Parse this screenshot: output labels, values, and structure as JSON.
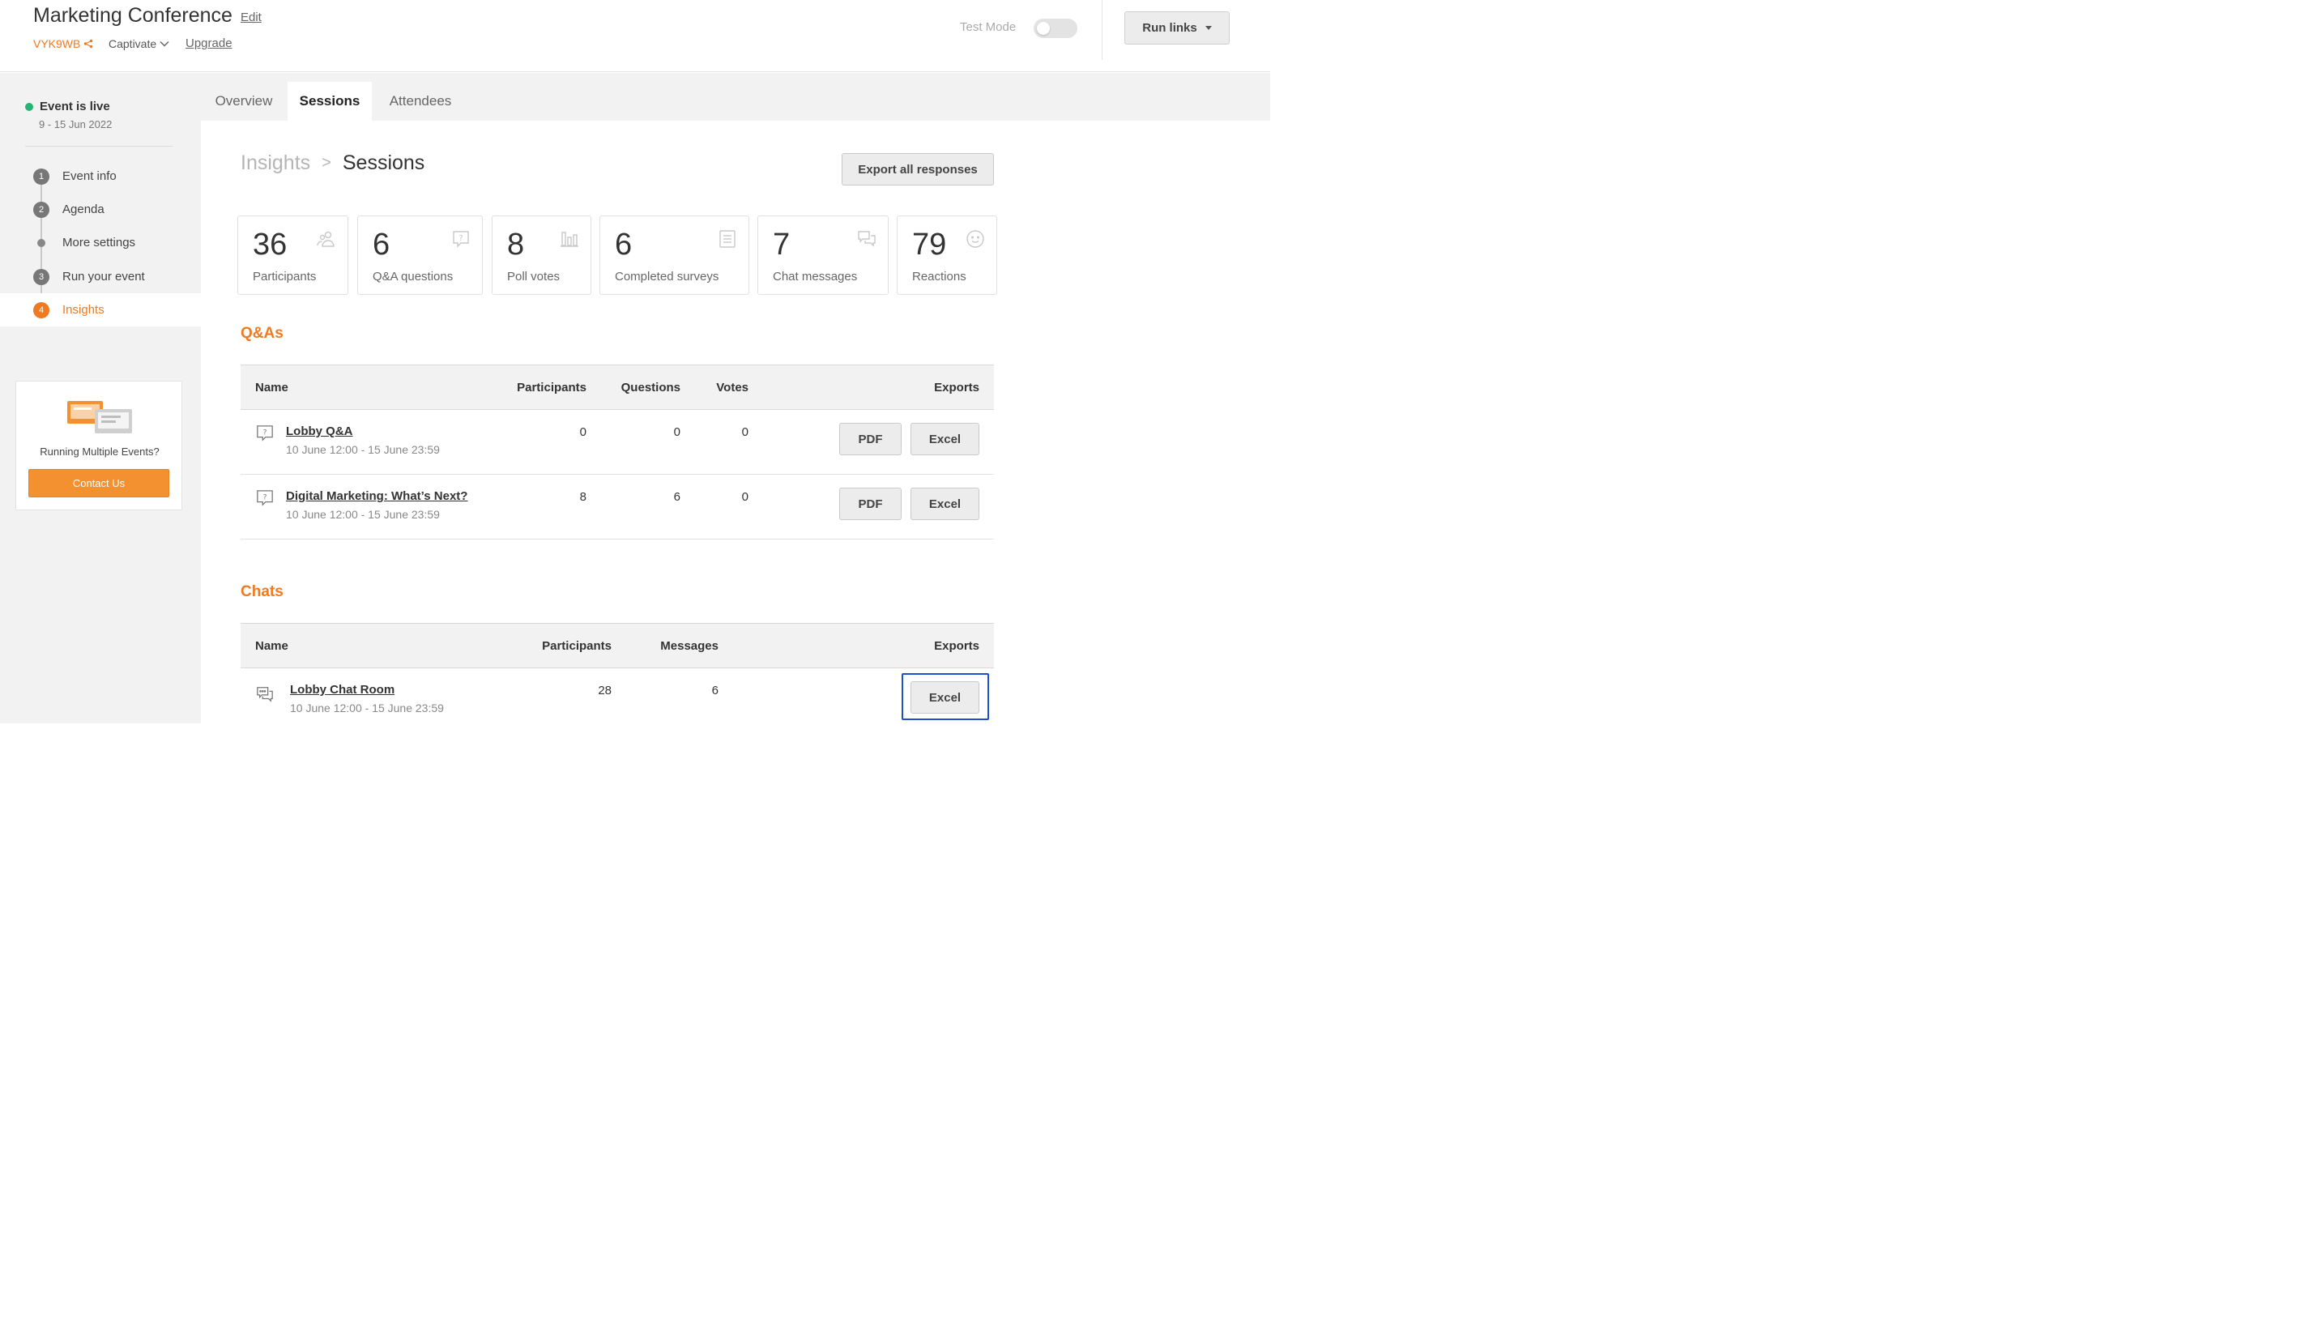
{
  "header": {
    "title": "Marketing Conference",
    "edit_label": "Edit",
    "event_code": "VYK9WB",
    "plan": "Captivate",
    "upgrade_label": "Upgrade",
    "test_mode_label": "Test Mode",
    "test_mode_on": false,
    "run_links_label": "Run links"
  },
  "sidebar": {
    "status": "Event is live",
    "dates": "9 - 15 Jun 2022",
    "steps": [
      {
        "marker": "1",
        "label": "Event info"
      },
      {
        "marker": "2",
        "label": "Agenda"
      },
      {
        "marker": "",
        "label": "More settings"
      },
      {
        "marker": "3",
        "label": "Run your event"
      },
      {
        "marker": "4",
        "label": "Insights"
      }
    ],
    "active_step": "Insights",
    "promo": {
      "text": "Running Multiple Events?",
      "button": "Contact Us"
    }
  },
  "tabs": [
    "Overview",
    "Sessions",
    "Attendees"
  ],
  "active_tab": "Sessions",
  "breadcrumb": {
    "root": "Insights",
    "separator": ">",
    "current": "Sessions"
  },
  "export_all_label": "Export all responses",
  "stats": [
    {
      "value": "36",
      "label": "Participants",
      "icon": "people-icon"
    },
    {
      "value": "6",
      "label": "Q&A questions",
      "icon": "question-bubble-icon"
    },
    {
      "value": "8",
      "label": "Poll votes",
      "icon": "bar-chart-icon"
    },
    {
      "value": "6",
      "label": "Completed surveys",
      "icon": "survey-list-icon"
    },
    {
      "value": "7",
      "label": "Chat messages",
      "icon": "chat-bubbles-icon"
    },
    {
      "value": "79",
      "label": "Reactions",
      "icon": "smiley-icon"
    }
  ],
  "qas": {
    "title": "Q&As",
    "columns": {
      "name": "Name",
      "participants": "Participants",
      "questions": "Questions",
      "votes": "Votes",
      "exports": "Exports"
    },
    "rows": [
      {
        "name": "Lobby Q&A",
        "dates": "10 June 12:00 - 15 June 23:59",
        "participants": "0",
        "questions": "0",
        "votes": "0",
        "pdf": "PDF",
        "excel": "Excel"
      },
      {
        "name": "Digital Marketing: What’s Next?",
        "dates": "10 June 12:00 - 15 June 23:59",
        "participants": "8",
        "questions": "6",
        "votes": "0",
        "pdf": "PDF",
        "excel": "Excel"
      }
    ]
  },
  "chats": {
    "title": "Chats",
    "columns": {
      "name": "Name",
      "participants": "Participants",
      "messages": "Messages",
      "exports": "Exports"
    },
    "rows": [
      {
        "name": "Lobby Chat Room",
        "dates": "10 June 12:00 - 15 June 23:59",
        "participants": "28",
        "messages": "6",
        "excel": "Excel"
      }
    ]
  },
  "colors": {
    "accent": "#ef7a22",
    "live": "#22b573",
    "highlight": "#1f4fd1"
  }
}
